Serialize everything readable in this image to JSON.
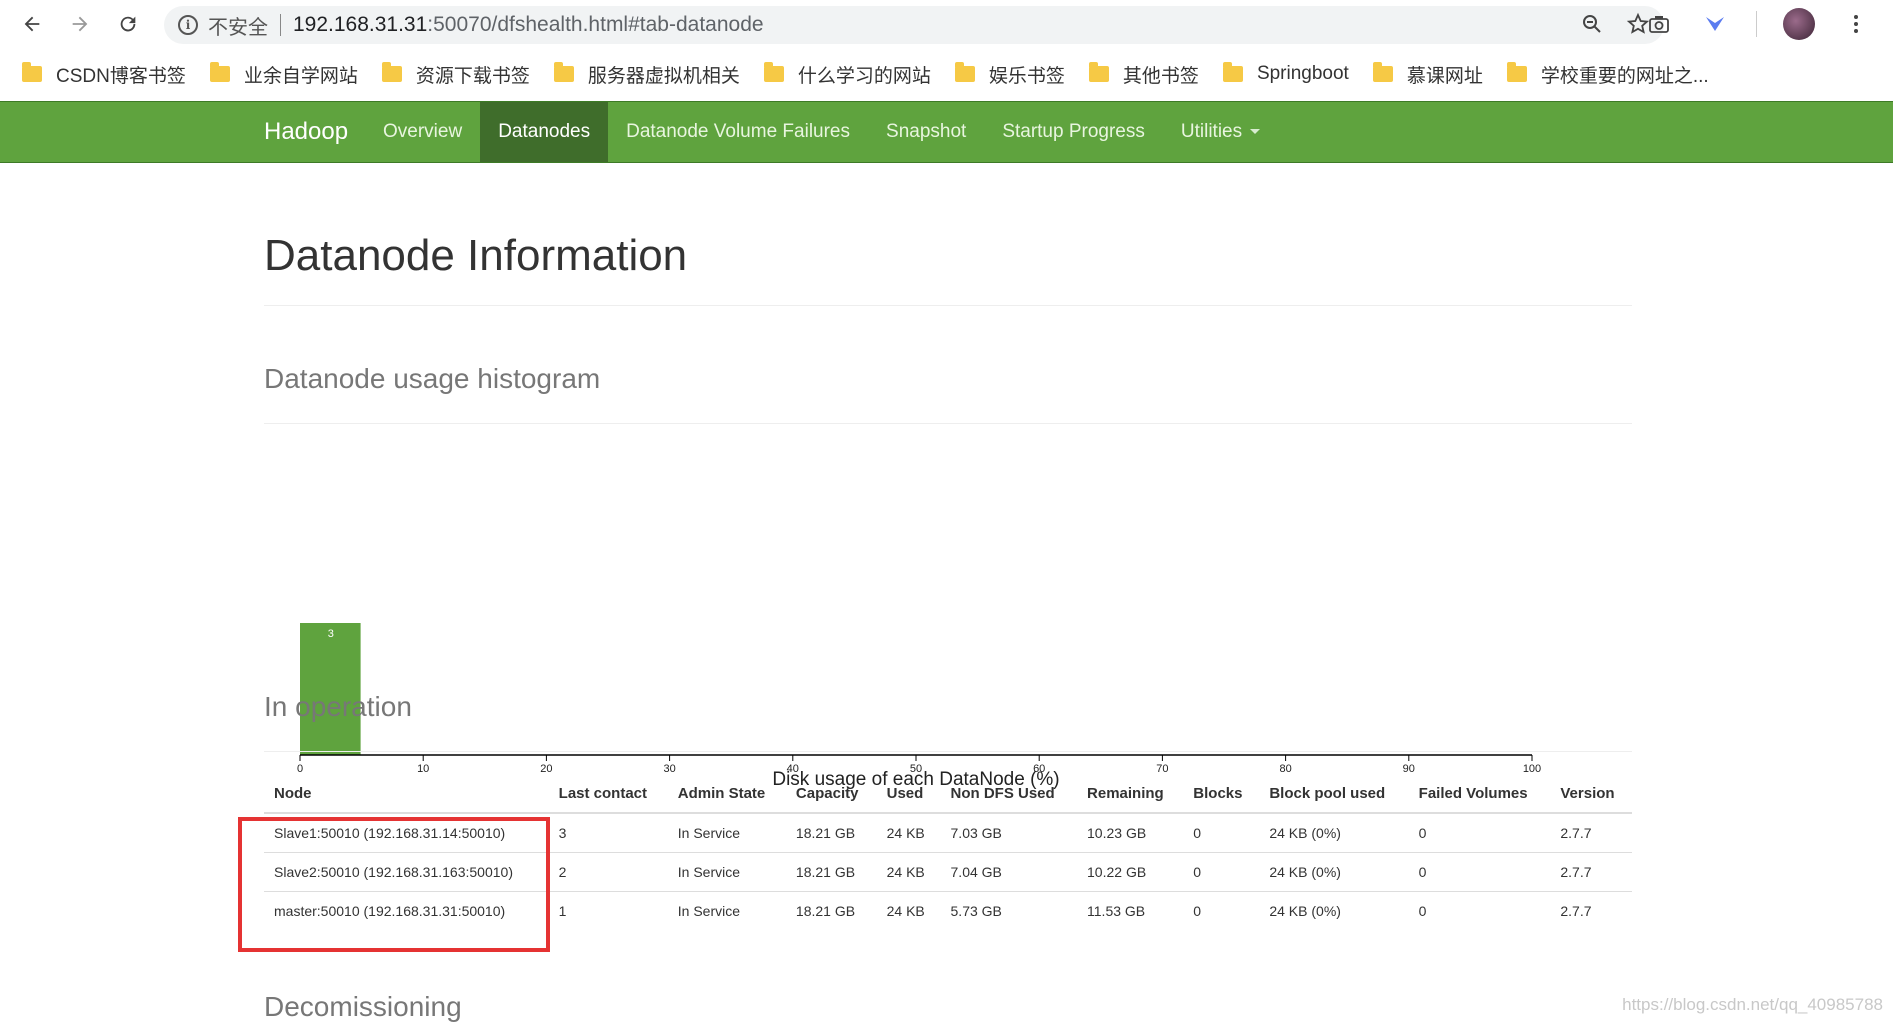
{
  "browser": {
    "insecure_label": "不安全",
    "url_host": "192.168.31.31",
    "url_rest": ":50070/dfshealth.html#tab-datanode",
    "bookmarks": [
      "CSDN博客书签",
      "业余自学网站",
      "资源下载书签",
      "服务器虚拟机相关",
      "什么学习的网站",
      "娱乐书签",
      "其他书签",
      "Springboot",
      "慕课网址",
      "学校重要的网址之..."
    ]
  },
  "navbar": {
    "brand": "Hadoop",
    "items": [
      "Overview",
      "Datanodes",
      "Datanode Volume Failures",
      "Snapshot",
      "Startup Progress",
      "Utilities"
    ],
    "active": "Datanodes",
    "color": "#5fa33e"
  },
  "page": {
    "title": "Datanode Information",
    "histogram_heading": "Datanode usage histogram",
    "operation_heading": "In operation",
    "decom_heading": "Decomissioning"
  },
  "chart_data": {
    "type": "bar",
    "bins": [
      [
        0,
        5
      ]
    ],
    "values": [
      3
    ],
    "data_labels": [
      "3"
    ],
    "xlabel": "Disk usage of each DataNode (%)",
    "xlim": [
      0,
      100
    ],
    "xticks": [
      "0",
      "10",
      "20",
      "30",
      "40",
      "50",
      "60",
      "70",
      "80",
      "90",
      "100"
    ],
    "ylim": [
      0,
      3
    ],
    "bar_color": "#5fa33e"
  },
  "table": {
    "headers": [
      "Node",
      "Last contact",
      "Admin State",
      "Capacity",
      "Used",
      "Non DFS Used",
      "Remaining",
      "Blocks",
      "Block pool used",
      "Failed Volumes",
      "Version"
    ],
    "rows": [
      [
        "Slave1:50010 (192.168.31.14:50010)",
        "3",
        "In Service",
        "18.21 GB",
        "24 KB",
        "7.03 GB",
        "10.23 GB",
        "0",
        "24 KB (0%)",
        "0",
        "2.7.7"
      ],
      [
        "Slave2:50010 (192.168.31.163:50010)",
        "2",
        "In Service",
        "18.21 GB",
        "24 KB",
        "7.04 GB",
        "10.22 GB",
        "0",
        "24 KB (0%)",
        "0",
        "2.7.7"
      ],
      [
        "master:50010 (192.168.31.31:50010)",
        "1",
        "In Service",
        "18.21 GB",
        "24 KB",
        "5.73 GB",
        "11.53 GB",
        "0",
        "24 KB (0%)",
        "0",
        "2.7.7"
      ]
    ]
  },
  "watermark": "https://blog.csdn.net/qq_40985788"
}
